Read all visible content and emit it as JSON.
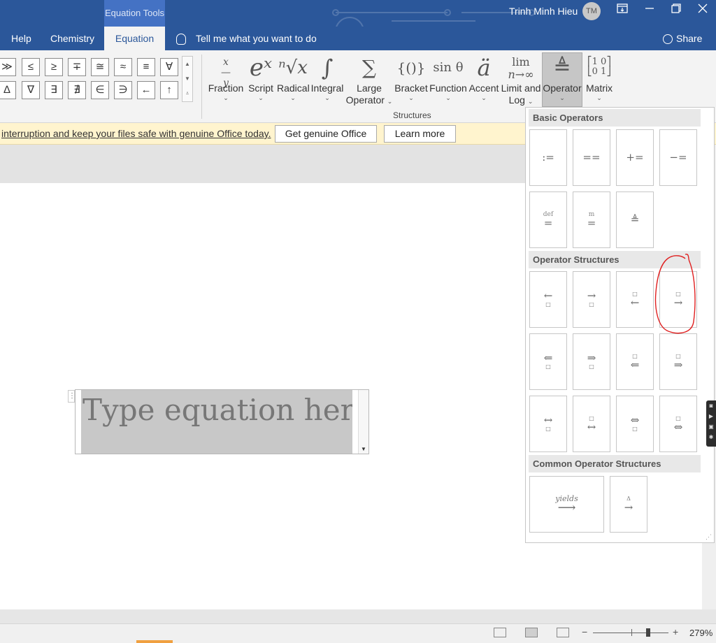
{
  "titlebar": {
    "context_tab": "Equation Tools",
    "user_name": "Trinh Minh Hieu",
    "user_initials": "TM",
    "icons": [
      "ribbon-display-icon",
      "minimize-icon",
      "restore-icon",
      "close-icon"
    ]
  },
  "menu": {
    "tabs": [
      {
        "label": "Help",
        "active": false
      },
      {
        "label": "Chemistry",
        "active": false
      },
      {
        "label": "Equation",
        "active": true
      }
    ],
    "tell_me": "Tell me what you want to do",
    "share": "Share"
  },
  "symbols": {
    "row1": [
      "≫",
      "≤",
      "≥",
      "∓",
      "≅",
      "≈",
      "≡",
      "∀"
    ],
    "row2": [
      "∆",
      "∇",
      "∃",
      "∄",
      "∈",
      "∋",
      "←",
      "↑"
    ]
  },
  "structures": {
    "group_label": "Structures",
    "items": [
      {
        "label": "Fraction",
        "glyph": "x/y"
      },
      {
        "label": "Script",
        "glyph": "eˣ"
      },
      {
        "label": "Radical",
        "glyph": "ⁿ√x"
      },
      {
        "label": "Integral",
        "glyph": "∫"
      },
      {
        "label": "Large",
        "label2": "Operator",
        "glyph": "∑"
      },
      {
        "label": "Bracket",
        "glyph": "{()}"
      },
      {
        "label": "Function",
        "glyph": "sin θ"
      },
      {
        "label": "Accent",
        "glyph": "ä"
      },
      {
        "label": "Limit and",
        "label2": "Log",
        "glyph": "lim"
      },
      {
        "label": "Operator",
        "glyph": "≜",
        "active": true
      },
      {
        "label": "Matrix",
        "glyph": "[10 01]"
      }
    ]
  },
  "message_bar": {
    "text": "interruption and keep your files safe with genuine Office today.",
    "button1": "Get genuine Office",
    "button2": "Learn more"
  },
  "equation": {
    "placeholder": "Type equation here."
  },
  "operator_panel": {
    "sections": [
      {
        "title": "Basic Operators"
      },
      {
        "title": "Operator Structures"
      },
      {
        "title": "Common Operator Structures"
      }
    ],
    "basic": [
      ":=",
      "==",
      "+=",
      "−=",
      "def",
      "m",
      "≜"
    ],
    "common": [
      {
        "over": "yields",
        "arrow": "⟶"
      },
      {
        "over": "Δ",
        "arrow": "→"
      }
    ],
    "highlighted_item": "overset-right-arrow"
  },
  "status": {
    "zoom": "279%"
  },
  "colors": {
    "brand_blue": "#2b579a",
    "message_bar": "#fff4ce",
    "annotation_red": "#e02020"
  }
}
